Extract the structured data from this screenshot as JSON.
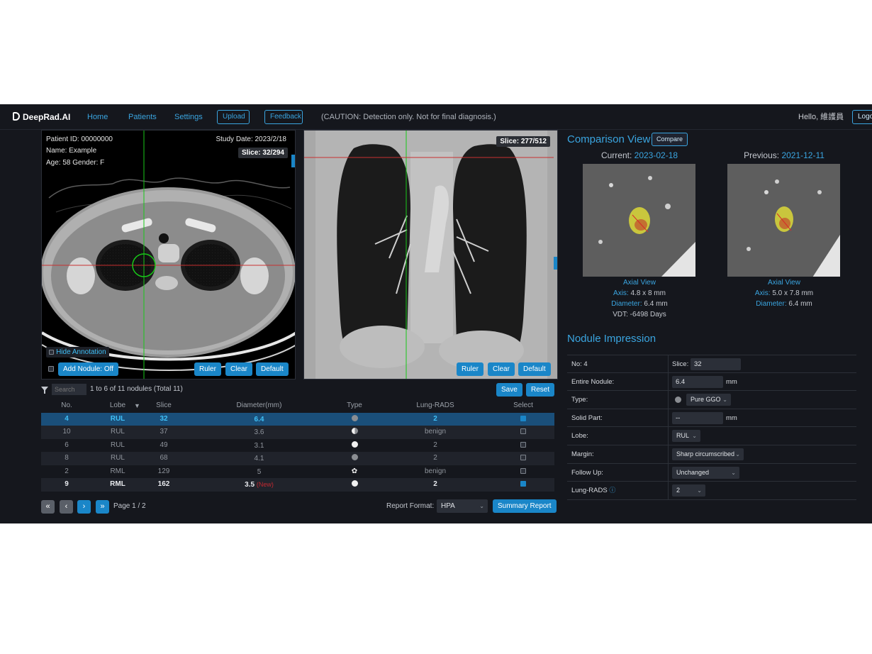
{
  "navbar": {
    "brand": "DeepRad.AI",
    "links": [
      "Home",
      "Patients",
      "Settings"
    ],
    "upload_label": "Upload",
    "feedback_label": "Feedback",
    "caution": "(CAUTION: Detection only. Not for final diagnosis.)",
    "greeting": "Hello, 維護員",
    "logout_label": "Logo"
  },
  "axial_view": {
    "patient_id": "Patient ID: 00000000",
    "name": "Name: Example",
    "age_gender": "Age: 58 Gender: F",
    "study_date": "Study Date: 2023/2/18",
    "slice": "Slice: 32/294",
    "hide_annotation_label": "Hide Annotation",
    "add_nodule_label": "Add Nodule: Off",
    "buttons": [
      "Ruler",
      "Clear",
      "Default"
    ]
  },
  "coronal_view": {
    "slice": "Slice: 277/512",
    "buttons": [
      "Ruler",
      "Clear",
      "Default"
    ]
  },
  "table": {
    "search_placeholder": "Search",
    "summary": "1 to 6 of 11 nodules (Total 11)",
    "save_label": "Save",
    "reset_label": "Reset",
    "headers": [
      "No.",
      "Lobe",
      "Slice",
      "Diameter(mm)",
      "Type",
      "Lung-RADS",
      "Select"
    ],
    "rows": [
      {
        "no": "4",
        "lobe": "RUL",
        "slice": "32",
        "diameter": "6.4",
        "new": "",
        "type": "pure-ggo",
        "lungrads": "2",
        "selected": true
      },
      {
        "no": "10",
        "lobe": "RUL",
        "slice": "37",
        "diameter": "3.6",
        "new": "",
        "type": "part-solid",
        "lungrads": "benign",
        "selected": false
      },
      {
        "no": "6",
        "lobe": "RUL",
        "slice": "49",
        "diameter": "3.1",
        "new": "",
        "type": "solid",
        "lungrads": "2",
        "selected": false
      },
      {
        "no": "8",
        "lobe": "RUL",
        "slice": "68",
        "diameter": "4.1",
        "new": "",
        "type": "pure-ggo",
        "lungrads": "2",
        "selected": false
      },
      {
        "no": "2",
        "lobe": "RML",
        "slice": "129",
        "diameter": "5",
        "new": "",
        "type": "calcified",
        "lungrads": "benign",
        "selected": false
      },
      {
        "no": "9",
        "lobe": "RML",
        "slice": "162",
        "diameter": "3.5",
        "new": "(New)",
        "type": "solid",
        "lungrads": "2",
        "selected": true
      }
    ],
    "page": "Page 1 / 2",
    "report_format_label": "Report Format:",
    "report_format_value": "HPA",
    "summary_report_label": "Summary Report"
  },
  "comparison": {
    "title": "Comparison View",
    "compare_label": "Compare",
    "current": {
      "label": "Current:",
      "date": "2023-02-18",
      "view": "Axial View",
      "axis_label": "Axis:",
      "axis": "4.8 x 8 mm",
      "diameter_label": "Diameter:",
      "diameter": "6.4 mm",
      "vdt_label": "VDT:",
      "vdt": "-6498 Days"
    },
    "previous": {
      "label": "Previous:",
      "date": "2021-12-11",
      "view": "Axial View",
      "axis_label": "Axis:",
      "axis": "5.0 x 7.8 mm",
      "diameter_label": "Diameter:",
      "diameter": "6.4 mm"
    }
  },
  "impression": {
    "title": "Nodule Impression",
    "no": "No: 4",
    "slice_label": "Slice:",
    "slice_value": "32",
    "entire_label": "Entire Nodule:",
    "entire_value": "6.4",
    "entire_unit": "mm",
    "type_label": "Type:",
    "type_value": "Pure GGO",
    "solid_label": "Solid Part:",
    "solid_value": "--",
    "solid_unit": "mm",
    "lobe_label": "Lobe:",
    "lobe_value": "RUL",
    "margin_label": "Margin:",
    "margin_value": "Sharp circumscribed",
    "followup_label": "Follow Up:",
    "followup_value": "Unchanged",
    "lungrads_label": "Lung-RADS",
    "lungrads_value": "2"
  },
  "colors": {
    "accent": "#3aa5e0",
    "button": "#1a86c8",
    "background": "#15171d",
    "selected_row": "#1a4f7a",
    "new_badge": "#c02830"
  }
}
